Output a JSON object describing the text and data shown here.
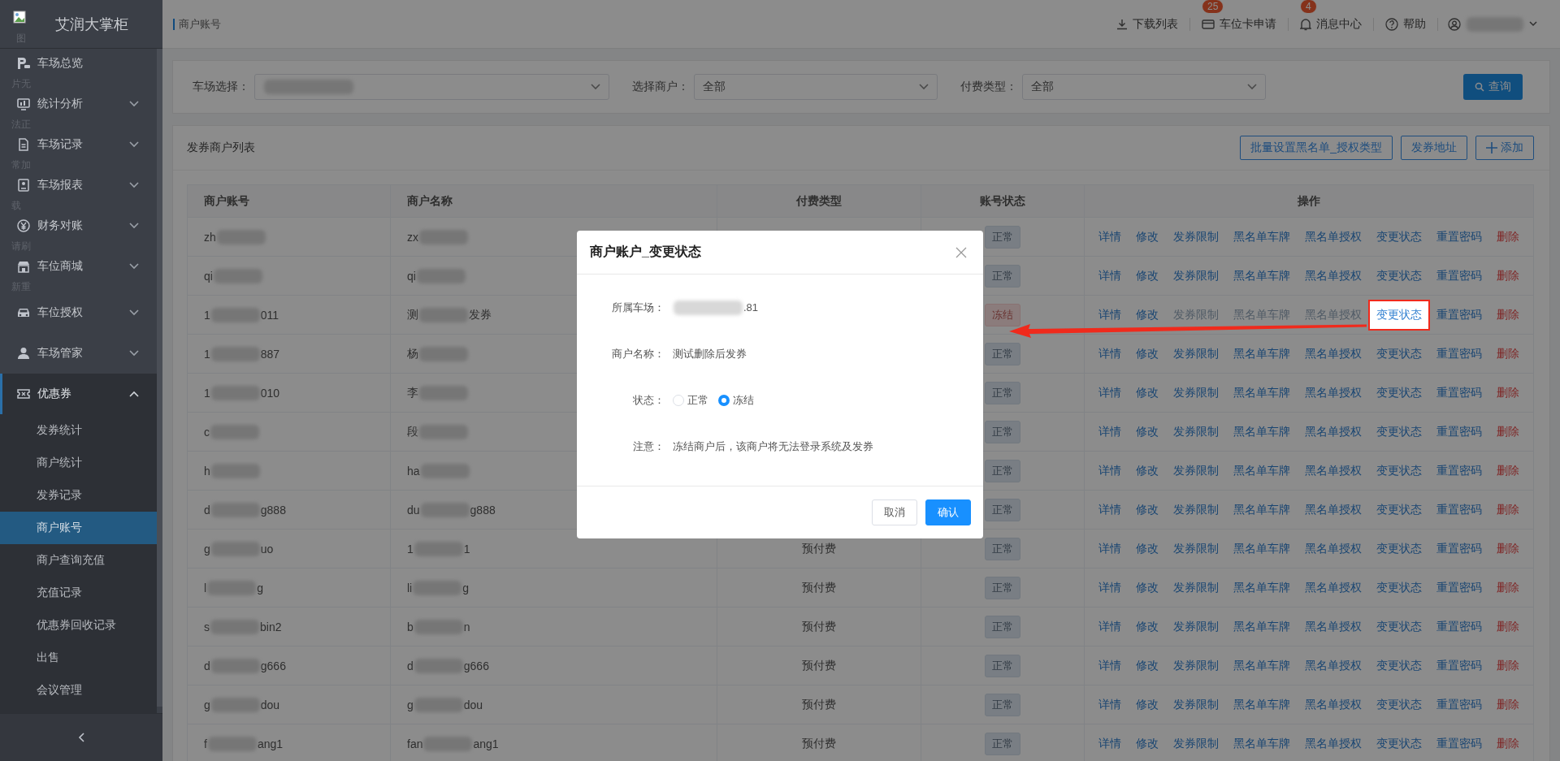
{
  "app": {
    "title": "艾润大掌柜"
  },
  "logo_alt_fragments": [
    "图",
    "片无",
    "法正",
    "常加",
    "载",
    "请刷",
    "新重"
  ],
  "sidebar": {
    "items": [
      {
        "label": "车场总览",
        "expandable": false,
        "expanded": false,
        "selected": false
      },
      {
        "label": "统计分析",
        "expandable": true,
        "expanded": false,
        "selected": false
      },
      {
        "label": "车场记录",
        "expandable": true,
        "expanded": false,
        "selected": false
      },
      {
        "label": "车场报表",
        "expandable": true,
        "expanded": false,
        "selected": false
      },
      {
        "label": "财务对账",
        "expandable": true,
        "expanded": false,
        "selected": false
      },
      {
        "label": "车位商城",
        "expandable": true,
        "expanded": false,
        "selected": false
      },
      {
        "label": "车位授权",
        "expandable": true,
        "expanded": false,
        "selected": false
      },
      {
        "label": "车场管家",
        "expandable": true,
        "expanded": false,
        "selected": false
      },
      {
        "label": "优惠券",
        "expandable": true,
        "expanded": true,
        "selected": true,
        "children": [
          {
            "label": "发券统计",
            "selected": false
          },
          {
            "label": "商户统计",
            "selected": false
          },
          {
            "label": "发券记录",
            "selected": false
          },
          {
            "label": "商户账号",
            "selected": true
          },
          {
            "label": "商户查询充值",
            "selected": false
          },
          {
            "label": "充值记录",
            "selected": false
          },
          {
            "label": "优惠券回收记录",
            "selected": false
          },
          {
            "label": "出售",
            "selected": false
          },
          {
            "label": "会议管理",
            "selected": false
          }
        ]
      }
    ]
  },
  "topbar": {
    "breadcrumb": "商户账号",
    "actions": [
      {
        "label": "下载列表"
      },
      {
        "label": "车位卡申请",
        "badge": "25"
      },
      {
        "label": "消息中心",
        "badge": "4"
      },
      {
        "label": "帮助"
      }
    ]
  },
  "filters": {
    "fields": [
      {
        "label": "车场选择：",
        "masked": true
      },
      {
        "label": "选择商户：",
        "value": "全部",
        "masked": false
      },
      {
        "label": "付费类型：",
        "value": "全部",
        "masked": false
      }
    ],
    "search_button": "查询"
  },
  "list": {
    "title": "发券商户列表",
    "buttons": [
      "批量设置黑名单_授权类型",
      "发券地址",
      "添加"
    ],
    "columns": [
      "商户账号",
      "商户名称",
      "付费类型",
      "账号状态",
      "操作"
    ],
    "rows": [
      {
        "account": {
          "start": "zh",
          "masked": true
        },
        "name": {
          "start": "zx",
          "masked": true
        },
        "status": {
          "label": "正常",
          "kind": "normal"
        },
        "ops": [
          {
            "label": "详情",
            "kind": "link",
            "disabled": false,
            "highlighted": false
          },
          {
            "label": "修改",
            "kind": "link",
            "disabled": false,
            "highlighted": false
          },
          {
            "label": "发券限制",
            "kind": "link",
            "disabled": false,
            "highlighted": false
          },
          {
            "label": "黑名单车牌",
            "kind": "link",
            "disabled": false,
            "highlighted": false
          },
          {
            "label": "黑名单授权",
            "kind": "link",
            "disabled": false,
            "highlighted": false
          },
          {
            "label": "变更状态",
            "kind": "link",
            "disabled": false,
            "highlighted": false
          },
          {
            "label": "重置密码",
            "kind": "link",
            "disabled": false,
            "highlighted": false
          },
          {
            "label": "删除",
            "kind": "danger",
            "disabled": false,
            "highlighted": false
          }
        ]
      },
      {
        "account": {
          "start": "qi",
          "masked": true
        },
        "name": {
          "start": "qi",
          "masked": true
        },
        "status": {
          "label": "正常",
          "kind": "normal"
        },
        "ops": [
          {
            "label": "详情",
            "kind": "link",
            "disabled": false,
            "highlighted": false
          },
          {
            "label": "修改",
            "kind": "link",
            "disabled": false,
            "highlighted": false
          },
          {
            "label": "发券限制",
            "kind": "link",
            "disabled": false,
            "highlighted": false
          },
          {
            "label": "黑名单车牌",
            "kind": "link",
            "disabled": false,
            "highlighted": false
          },
          {
            "label": "黑名单授权",
            "kind": "link",
            "disabled": false,
            "highlighted": false
          },
          {
            "label": "变更状态",
            "kind": "link",
            "disabled": false,
            "highlighted": false
          },
          {
            "label": "重置密码",
            "kind": "link",
            "disabled": false,
            "highlighted": false
          },
          {
            "label": "删除",
            "kind": "danger",
            "disabled": false,
            "highlighted": false
          }
        ]
      },
      {
        "account": {
          "start": "1",
          "end": "011",
          "masked": true
        },
        "name": {
          "start": "测",
          "end": "发券",
          "masked": true
        },
        "status": {
          "label": "冻结",
          "kind": "frozen"
        },
        "ops": [
          {
            "label": "详情",
            "kind": "link",
            "disabled": false,
            "highlighted": false
          },
          {
            "label": "修改",
            "kind": "link",
            "disabled": false,
            "highlighted": false
          },
          {
            "label": "发券限制",
            "kind": "link",
            "disabled": true,
            "highlighted": false
          },
          {
            "label": "黑名单车牌",
            "kind": "link",
            "disabled": true,
            "highlighted": false
          },
          {
            "label": "黑名单授权",
            "kind": "link",
            "disabled": true,
            "highlighted": false
          },
          {
            "label": "变更状态",
            "kind": "link",
            "disabled": false,
            "highlighted": true
          },
          {
            "label": "重置密码",
            "kind": "link",
            "disabled": false,
            "highlighted": false
          },
          {
            "label": "删除",
            "kind": "danger",
            "disabled": false,
            "highlighted": false
          }
        ]
      },
      {
        "account": {
          "start": "1",
          "end": "887",
          "masked": true
        },
        "name": {
          "start": "杨",
          "masked": true
        },
        "status": {
          "label": "正常",
          "kind": "normal"
        },
        "ops": [
          {
            "label": "详情",
            "kind": "link",
            "disabled": false,
            "highlighted": false
          },
          {
            "label": "修改",
            "kind": "link",
            "disabled": false,
            "highlighted": false
          },
          {
            "label": "发券限制",
            "kind": "link",
            "disabled": false,
            "highlighted": false
          },
          {
            "label": "黑名单车牌",
            "kind": "link",
            "disabled": false,
            "highlighted": false
          },
          {
            "label": "黑名单授权",
            "kind": "link",
            "disabled": false,
            "highlighted": false
          },
          {
            "label": "变更状态",
            "kind": "link",
            "disabled": false,
            "highlighted": false
          },
          {
            "label": "重置密码",
            "kind": "link",
            "disabled": false,
            "highlighted": false
          },
          {
            "label": "删除",
            "kind": "danger",
            "disabled": false,
            "highlighted": false
          }
        ]
      },
      {
        "account": {
          "start": "1",
          "end": "010",
          "masked": true
        },
        "name": {
          "start": "李",
          "masked": true
        },
        "status": {
          "label": "正常",
          "kind": "normal"
        },
        "ops": [
          {
            "label": "详情",
            "kind": "link",
            "disabled": false,
            "highlighted": false
          },
          {
            "label": "修改",
            "kind": "link",
            "disabled": false,
            "highlighted": false
          },
          {
            "label": "发券限制",
            "kind": "link",
            "disabled": false,
            "highlighted": false
          },
          {
            "label": "黑名单车牌",
            "kind": "link",
            "disabled": false,
            "highlighted": false
          },
          {
            "label": "黑名单授权",
            "kind": "link",
            "disabled": false,
            "highlighted": false
          },
          {
            "label": "变更状态",
            "kind": "link",
            "disabled": false,
            "highlighted": false
          },
          {
            "label": "重置密码",
            "kind": "link",
            "disabled": false,
            "highlighted": false
          },
          {
            "label": "删除",
            "kind": "danger",
            "disabled": false,
            "highlighted": false
          }
        ]
      },
      {
        "account": {
          "start": "c",
          "masked": true
        },
        "name": {
          "start": "段",
          "masked": true
        },
        "status": {
          "label": "正常",
          "kind": "normal"
        },
        "ops": [
          {
            "label": "详情",
            "kind": "link",
            "disabled": false,
            "highlighted": false
          },
          {
            "label": "修改",
            "kind": "link",
            "disabled": false,
            "highlighted": false
          },
          {
            "label": "发券限制",
            "kind": "link",
            "disabled": false,
            "highlighted": false
          },
          {
            "label": "黑名单车牌",
            "kind": "link",
            "disabled": false,
            "highlighted": false
          },
          {
            "label": "黑名单授权",
            "kind": "link",
            "disabled": false,
            "highlighted": false
          },
          {
            "label": "变更状态",
            "kind": "link",
            "disabled": false,
            "highlighted": false
          },
          {
            "label": "重置密码",
            "kind": "link",
            "disabled": false,
            "highlighted": false
          },
          {
            "label": "删除",
            "kind": "danger",
            "disabled": false,
            "highlighted": false
          }
        ]
      },
      {
        "account": {
          "start": "h",
          "masked": true
        },
        "name": {
          "start": "ha",
          "masked": true
        },
        "status": {
          "label": "正常",
          "kind": "normal"
        },
        "ops": [
          {
            "label": "详情",
            "kind": "link",
            "disabled": false,
            "highlighted": false
          },
          {
            "label": "修改",
            "kind": "link",
            "disabled": false,
            "highlighted": false
          },
          {
            "label": "发券限制",
            "kind": "link",
            "disabled": false,
            "highlighted": false
          },
          {
            "label": "黑名单车牌",
            "kind": "link",
            "disabled": false,
            "highlighted": false
          },
          {
            "label": "黑名单授权",
            "kind": "link",
            "disabled": false,
            "highlighted": false
          },
          {
            "label": "变更状态",
            "kind": "link",
            "disabled": false,
            "highlighted": false
          },
          {
            "label": "重置密码",
            "kind": "link",
            "disabled": false,
            "highlighted": false
          },
          {
            "label": "删除",
            "kind": "danger",
            "disabled": false,
            "highlighted": false
          }
        ]
      },
      {
        "account": {
          "start": "d",
          "end": "g888",
          "masked": true
        },
        "name": {
          "start": "du",
          "end": "g888",
          "masked": true
        },
        "status": {
          "label": "正常",
          "kind": "normal"
        },
        "ops": [
          {
            "label": "详情",
            "kind": "link",
            "disabled": false,
            "highlighted": false
          },
          {
            "label": "修改",
            "kind": "link",
            "disabled": false,
            "highlighted": false
          },
          {
            "label": "发券限制",
            "kind": "link",
            "disabled": false,
            "highlighted": false
          },
          {
            "label": "黑名单车牌",
            "kind": "link",
            "disabled": false,
            "highlighted": false
          },
          {
            "label": "黑名单授权",
            "kind": "link",
            "disabled": false,
            "highlighted": false
          },
          {
            "label": "变更状态",
            "kind": "link",
            "disabled": false,
            "highlighted": false
          },
          {
            "label": "重置密码",
            "kind": "link",
            "disabled": false,
            "highlighted": false
          },
          {
            "label": "删除",
            "kind": "danger",
            "disabled": false,
            "highlighted": false
          }
        ]
      },
      {
        "account": {
          "start": "g",
          "end": "uo",
          "masked": true
        },
        "name": {
          "start": "1",
          "end": "1",
          "masked": true
        },
        "pay_type": "预付费",
        "status": {
          "label": "正常",
          "kind": "normal"
        },
        "ops": [
          {
            "label": "详情",
            "kind": "link",
            "disabled": false,
            "highlighted": false
          },
          {
            "label": "修改",
            "kind": "link",
            "disabled": false,
            "highlighted": false
          },
          {
            "label": "发券限制",
            "kind": "link",
            "disabled": false,
            "highlighted": false
          },
          {
            "label": "黑名单车牌",
            "kind": "link",
            "disabled": false,
            "highlighted": false
          },
          {
            "label": "黑名单授权",
            "kind": "link",
            "disabled": false,
            "highlighted": false
          },
          {
            "label": "变更状态",
            "kind": "link",
            "disabled": false,
            "highlighted": false
          },
          {
            "label": "重置密码",
            "kind": "link",
            "disabled": false,
            "highlighted": false
          },
          {
            "label": "删除",
            "kind": "danger",
            "disabled": false,
            "highlighted": false
          }
        ]
      },
      {
        "account": {
          "start": "l",
          "end": "g",
          "masked": true
        },
        "name": {
          "start": "li",
          "end": "g",
          "masked": true
        },
        "pay_type": "预付费",
        "status": {
          "label": "正常",
          "kind": "normal"
        },
        "ops": [
          {
            "label": "详情",
            "kind": "link",
            "disabled": false,
            "highlighted": false
          },
          {
            "label": "修改",
            "kind": "link",
            "disabled": false,
            "highlighted": false
          },
          {
            "label": "发券限制",
            "kind": "link",
            "disabled": false,
            "highlighted": false
          },
          {
            "label": "黑名单车牌",
            "kind": "link",
            "disabled": false,
            "highlighted": false
          },
          {
            "label": "黑名单授权",
            "kind": "link",
            "disabled": false,
            "highlighted": false
          },
          {
            "label": "变更状态",
            "kind": "link",
            "disabled": false,
            "highlighted": false
          },
          {
            "label": "重置密码",
            "kind": "link",
            "disabled": false,
            "highlighted": false
          },
          {
            "label": "删除",
            "kind": "danger",
            "disabled": false,
            "highlighted": false
          }
        ]
      },
      {
        "account": {
          "start": "s",
          "end": "bin2",
          "masked": true
        },
        "name": {
          "start": "b",
          "end": "n",
          "masked": true
        },
        "pay_type": "预付费",
        "status": {
          "label": "正常",
          "kind": "normal"
        },
        "ops": [
          {
            "label": "详情",
            "kind": "link",
            "disabled": false,
            "highlighted": false
          },
          {
            "label": "修改",
            "kind": "link",
            "disabled": false,
            "highlighted": false
          },
          {
            "label": "发券限制",
            "kind": "link",
            "disabled": false,
            "highlighted": false
          },
          {
            "label": "黑名单车牌",
            "kind": "link",
            "disabled": false,
            "highlighted": false
          },
          {
            "label": "黑名单授权",
            "kind": "link",
            "disabled": false,
            "highlighted": false
          },
          {
            "label": "变更状态",
            "kind": "link",
            "disabled": false,
            "highlighted": false
          },
          {
            "label": "重置密码",
            "kind": "link",
            "disabled": false,
            "highlighted": false
          },
          {
            "label": "删除",
            "kind": "danger",
            "disabled": false,
            "highlighted": false
          }
        ]
      },
      {
        "account": {
          "start": "d",
          "end": "g666",
          "masked": true
        },
        "name": {
          "start": "d",
          "end": "g666",
          "masked": true
        },
        "pay_type": "预付费",
        "status": {
          "label": "正常",
          "kind": "normal"
        },
        "ops": [
          {
            "label": "详情",
            "kind": "link",
            "disabled": false,
            "highlighted": false
          },
          {
            "label": "修改",
            "kind": "link",
            "disabled": false,
            "highlighted": false
          },
          {
            "label": "发券限制",
            "kind": "link",
            "disabled": false,
            "highlighted": false
          },
          {
            "label": "黑名单车牌",
            "kind": "link",
            "disabled": false,
            "highlighted": false
          },
          {
            "label": "黑名单授权",
            "kind": "link",
            "disabled": false,
            "highlighted": false
          },
          {
            "label": "变更状态",
            "kind": "link",
            "disabled": false,
            "highlighted": false
          },
          {
            "label": "重置密码",
            "kind": "link",
            "disabled": false,
            "highlighted": false
          },
          {
            "label": "删除",
            "kind": "danger",
            "disabled": false,
            "highlighted": false
          }
        ]
      },
      {
        "account": {
          "start": "g",
          "end": "dou",
          "masked": true
        },
        "name": {
          "start": "g",
          "end": "dou",
          "masked": true
        },
        "pay_type": "预付费",
        "status": {
          "label": "正常",
          "kind": "normal"
        },
        "ops": [
          {
            "label": "详情",
            "kind": "link",
            "disabled": false,
            "highlighted": false
          },
          {
            "label": "修改",
            "kind": "link",
            "disabled": false,
            "highlighted": false
          },
          {
            "label": "发券限制",
            "kind": "link",
            "disabled": false,
            "highlighted": false
          },
          {
            "label": "黑名单车牌",
            "kind": "link",
            "disabled": false,
            "highlighted": false
          },
          {
            "label": "黑名单授权",
            "kind": "link",
            "disabled": false,
            "highlighted": false
          },
          {
            "label": "变更状态",
            "kind": "link",
            "disabled": false,
            "highlighted": false
          },
          {
            "label": "重置密码",
            "kind": "link",
            "disabled": false,
            "highlighted": false
          },
          {
            "label": "删除",
            "kind": "danger",
            "disabled": false,
            "highlighted": false
          }
        ]
      },
      {
        "account": {
          "start": "f",
          "end": "ang1",
          "masked": true
        },
        "name": {
          "start": "fan",
          "end": "ang1",
          "masked": true
        },
        "pay_type": "预付费",
        "status": {
          "label": "正常",
          "kind": "normal"
        },
        "ops": [
          {
            "label": "详情",
            "kind": "link",
            "disabled": false,
            "highlighted": false
          },
          {
            "label": "修改",
            "kind": "link",
            "disabled": false,
            "highlighted": false
          },
          {
            "label": "发券限制",
            "kind": "link",
            "disabled": false,
            "highlighted": false
          },
          {
            "label": "黑名单车牌",
            "kind": "link",
            "disabled": false,
            "highlighted": false
          },
          {
            "label": "黑名单授权",
            "kind": "link",
            "disabled": false,
            "highlighted": false
          },
          {
            "label": "变更状态",
            "kind": "link",
            "disabled": false,
            "highlighted": false
          },
          {
            "label": "重置密码",
            "kind": "link",
            "disabled": false,
            "highlighted": false
          },
          {
            "label": "删除",
            "kind": "danger",
            "disabled": false,
            "highlighted": false
          }
        ]
      }
    ]
  },
  "dialog": {
    "title": "商户账户_变更状态",
    "fields": [
      {
        "label": "所属车场：",
        "kind": "text",
        "value": {
          "end": ".81",
          "masked": true
        }
      },
      {
        "label": "商户名称：",
        "kind": "text",
        "value": {
          "start": "测试删除后发券",
          "masked": false
        }
      },
      {
        "label": "状态：",
        "kind": "radio",
        "options": [
          {
            "label": "正常",
            "selected": false
          },
          {
            "label": "冻结",
            "selected": true
          }
        ]
      },
      {
        "label": "注意：",
        "kind": "text",
        "value": {
          "start": "冻结商户后，该商户将无法登录系统及发券",
          "masked": false
        }
      }
    ],
    "buttons": [
      {
        "label": "取消",
        "kind": "default"
      },
      {
        "label": "确认",
        "kind": "primary"
      }
    ]
  }
}
